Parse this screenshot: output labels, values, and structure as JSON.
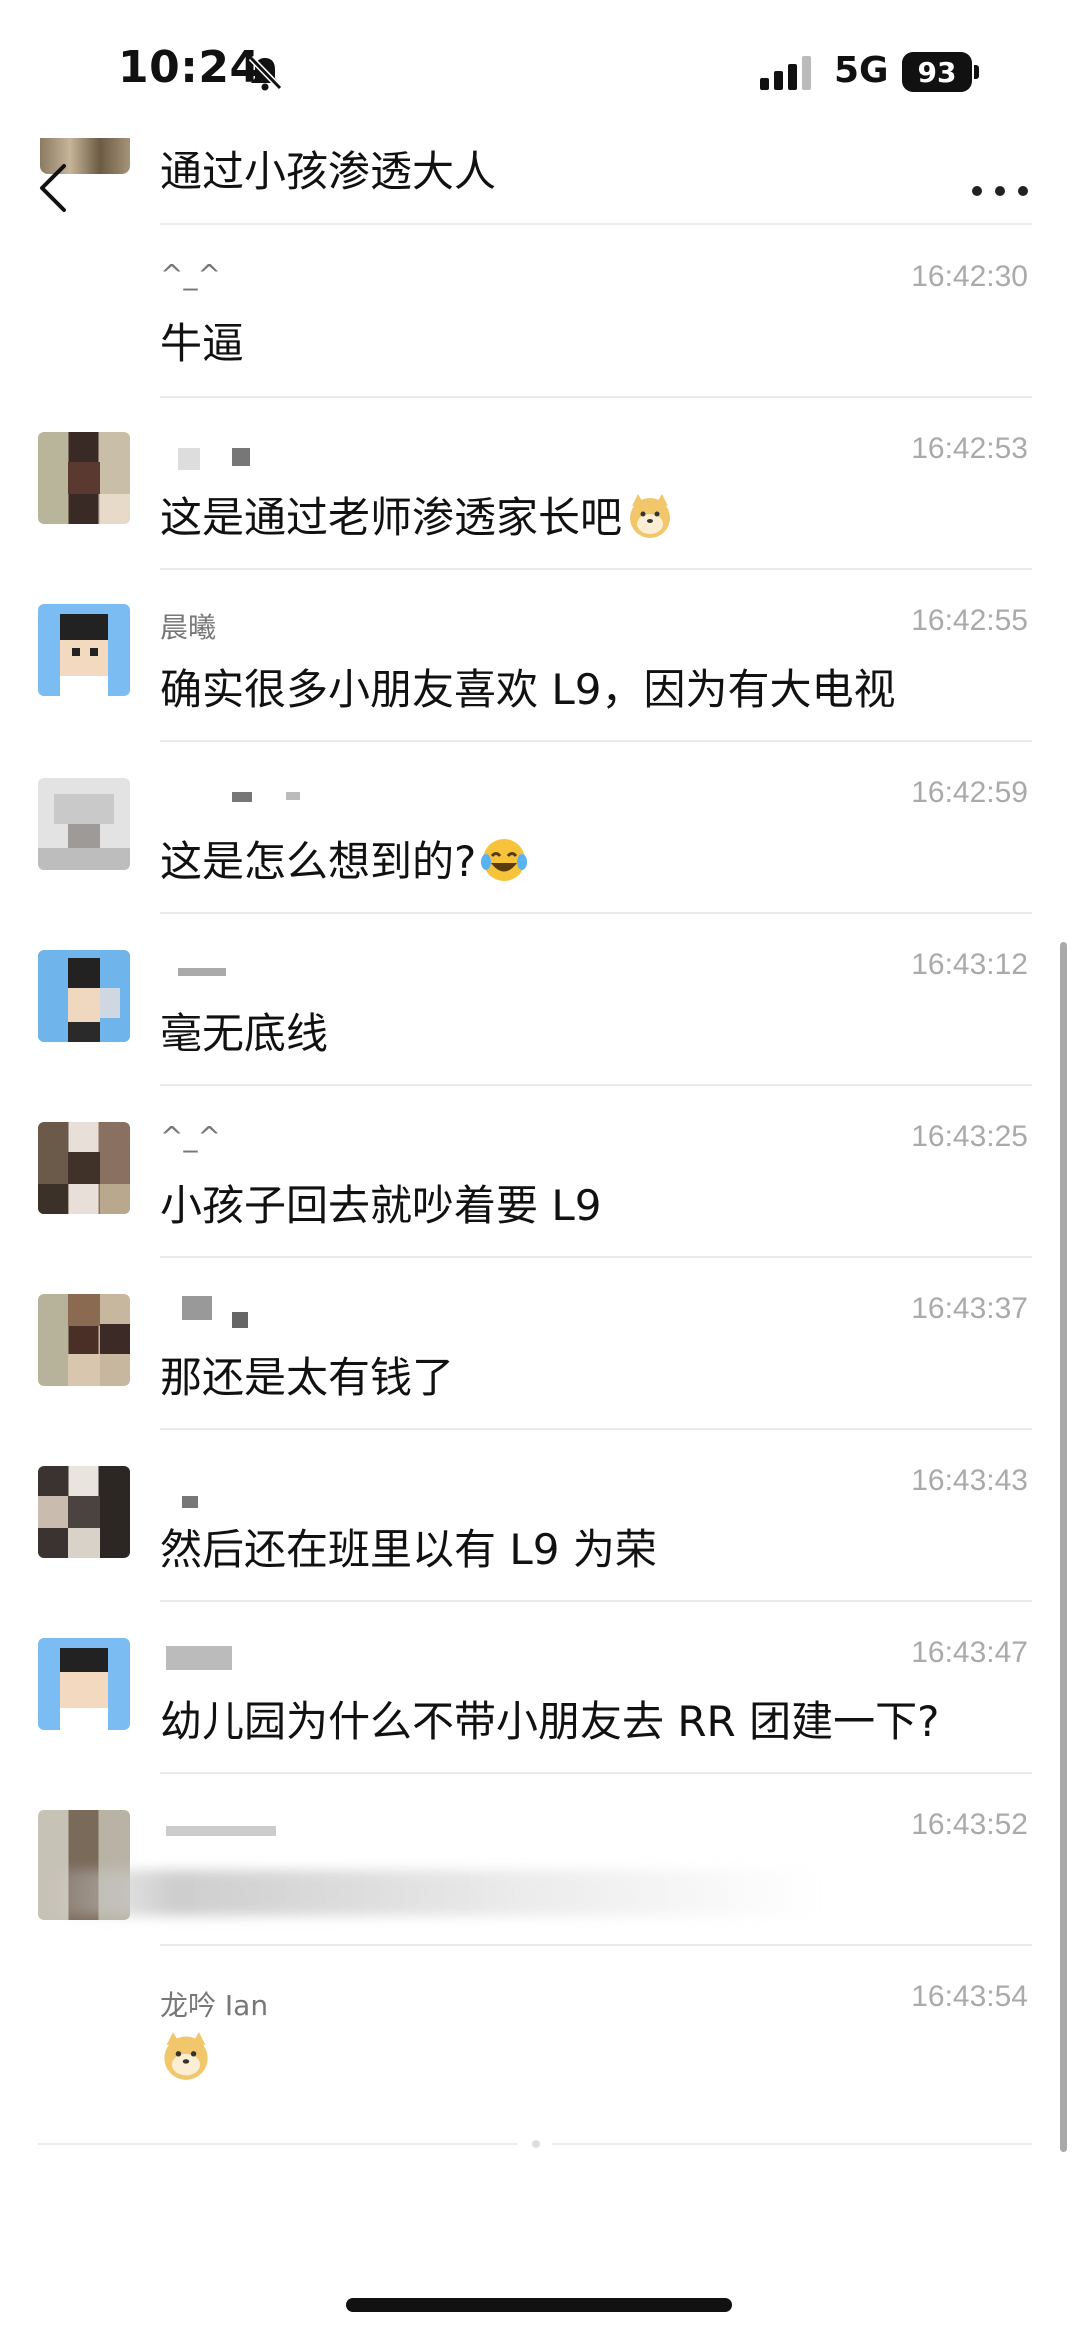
{
  "status_bar": {
    "time": "10:24",
    "network": "5G",
    "battery": "93"
  },
  "nav": {
    "title": "通过小孩渗透大人"
  },
  "messages": [
    {
      "sender": "^_^",
      "time": "16:42:30",
      "text": "牛逼",
      "emoji": ""
    },
    {
      "sender": "",
      "time": "16:42:53",
      "text": "这是通过老师渗透家长吧",
      "emoji": "doge-emoji"
    },
    {
      "sender": "晨曦",
      "time": "16:42:55",
      "text": "确实很多小朋友喜欢 L9，因为有大电视",
      "emoji": ""
    },
    {
      "sender": "",
      "time": "16:42:59",
      "text": "这是怎么想到的?",
      "emoji": "laughing-tears-emoji"
    },
    {
      "sender": "",
      "time": "16:43:12",
      "text": "毫无底线",
      "emoji": ""
    },
    {
      "sender": "^_^",
      "time": "16:43:25",
      "text": "小孩子回去就吵着要 L9",
      "emoji": ""
    },
    {
      "sender": "",
      "time": "16:43:37",
      "text": "那还是太有钱了",
      "emoji": ""
    },
    {
      "sender": "",
      "time": "16:43:43",
      "text": "然后还在班里以有 L9 为荣",
      "emoji": ""
    },
    {
      "sender": "",
      "time": "16:43:47",
      "text": "幼儿园为什么不带小朋友去 RR 团建一下?",
      "emoji": ""
    },
    {
      "sender": "",
      "time": "16:43:52",
      "text": "",
      "emoji": ""
    },
    {
      "sender": "龙吟 Ian",
      "time": "16:43:54",
      "text": "",
      "emoji": "doge-emoji"
    }
  ]
}
